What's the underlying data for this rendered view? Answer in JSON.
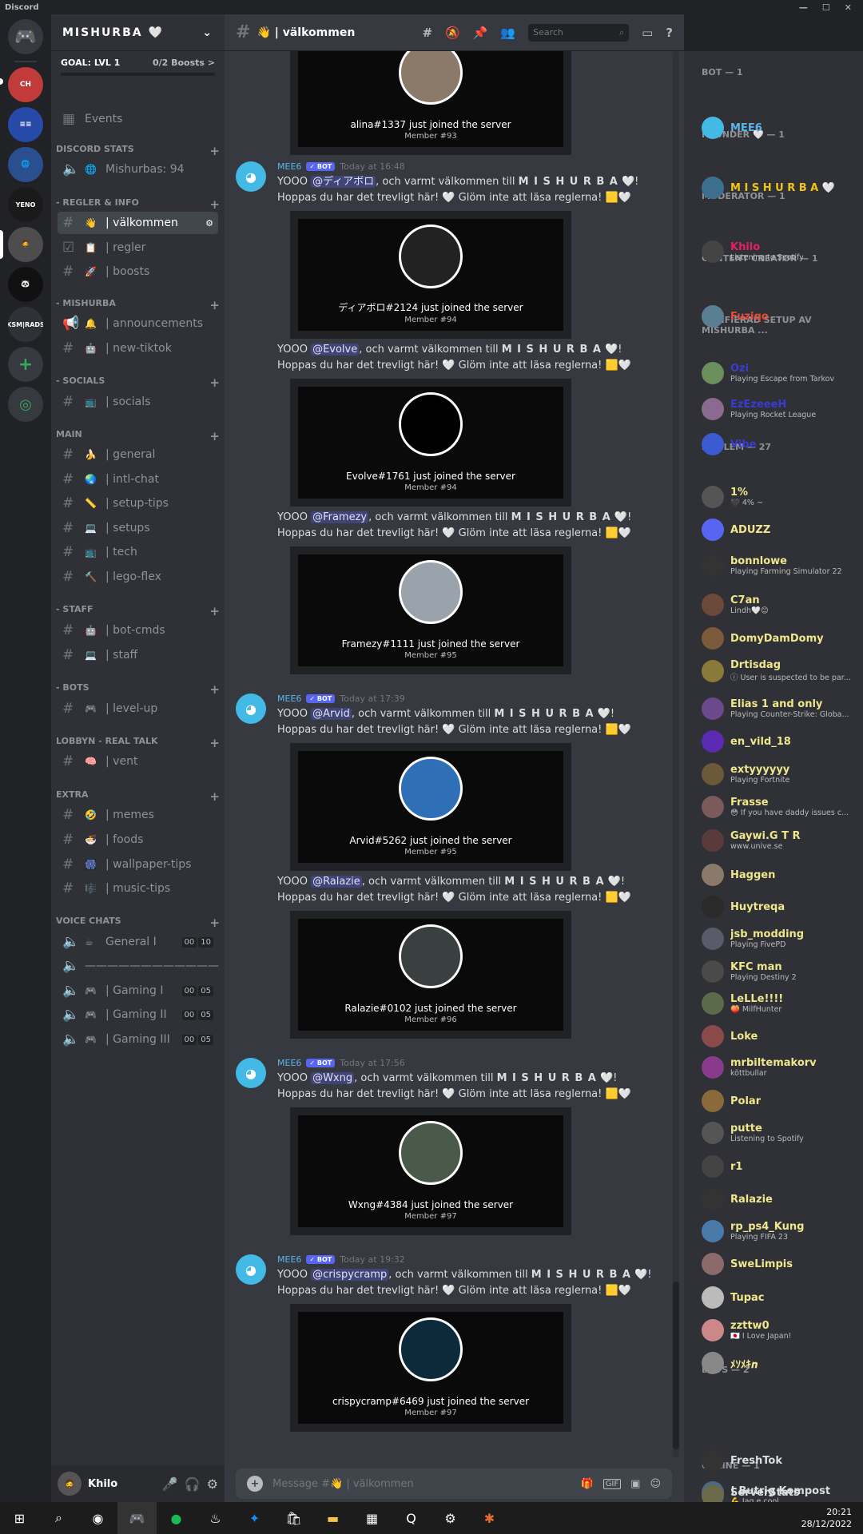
{
  "titlebar": {
    "app": "Discord"
  },
  "guild": {
    "name": "MISHURBA 🤍",
    "goal": "GOAL: LVL 1",
    "boosts": "0/2 Boosts >"
  },
  "servers": [
    {
      "label": "CH",
      "color": "#c23b3b"
    },
    {
      "label": "≡≡",
      "color": "#2749a8"
    },
    {
      "label": "🌐",
      "color": "#2a4f8f"
    },
    {
      "label": "YENO",
      "color": "#1a1a1a"
    },
    {
      "label": "🧔",
      "color": "#4d4d4d"
    },
    {
      "label": "🐼",
      "color": "#111"
    },
    {
      "label": "KSM|RADS",
      "color": "#2f3136"
    }
  ],
  "channels_list": {
    "events": "Events",
    "cat_stats": "DISCORD STATS",
    "stat_members": "Mishurbas: 94",
    "cat_rules": "- REGLER & INFO",
    "welcome": "| välkommen",
    "regler": "| regler",
    "boosts": "| boosts",
    "cat_mishurba": "- MISHURBA",
    "announcements": "| announcements",
    "newtiktok": "| new-tiktok",
    "cat_socials": "- SOCIALS",
    "socials": "| socials",
    "cat_main": "MAIN",
    "general": "| general",
    "intl": "| intl-chat",
    "setuptips": "| setup-tips",
    "setups": "| setups",
    "tech": "| tech",
    "lego": "| lego-flex",
    "cat_staff": "- STAFF",
    "botcmds": "| bot-cmds",
    "staff": "| staff",
    "cat_bots": "- BOTS",
    "levelup": "| level-up",
    "cat_lobbyn": "LOBBYN - REAL TALK",
    "vent": "| vent",
    "cat_extra": "EXTRA",
    "memes": "| memes",
    "foods": "| foods",
    "wallpaper": "| wallpaper-tips",
    "music": "| music-tips",
    "cat_voice": "VOICE CHATS",
    "general1": "General I",
    "divider": "————————————",
    "gaming1": "| Gaming I",
    "gaming2": "| Gaming II",
    "gaming3": "| Gaming III",
    "vc_g1a": "00",
    "vc_g1b": "10",
    "vc_ga": "00",
    "vc_gb": "05"
  },
  "channel_header": {
    "name": "👋 | välkommen",
    "search": "Search"
  },
  "user_panel": {
    "name": "Khilo"
  },
  "messages": {
    "bot": "MEE6",
    "badge": "✓ BOT",
    "t1": "Today at 16:48",
    "t2": "Today at 17:39",
    "t3": "Today at 17:56",
    "t4": "Today at 19:32",
    "welcome_pre": "YOOO ",
    "welcome_mid": ", och varmt välkommen till ",
    "server": "M I S H U R B A",
    "welcome_end": " 🤍! Hoppas du har det trevligt här! 🤍 Glöm inte att läsa reglerna! 🟨🤍",
    "m0": "@ディアボロ",
    "m1": "@Evolve",
    "m2": "@Framezy",
    "m3": "@Arvid",
    "m4": "@Ralazie",
    "m5": "@Wxng",
    "m6": "@crispycramp",
    "c_alina": "alina#1337 just joined the server",
    "n_alina": "Member #93",
    "c0": "ディアボロ#2124 just joined the server",
    "n0": "Member #94",
    "c1": "Evolve#1761 just joined the server",
    "n1": "Member #94",
    "c2": "Framezy#1111 just joined the server",
    "n2": "Member #95",
    "c3": "Arvid#5262 just joined the server",
    "n3": "Member #95",
    "c4": "Ralazie#0102 just joined the server",
    "n4": "Member #96",
    "c5": "Wxng#4384 just joined the server",
    "n5": "Member #97",
    "c6": "crispycramp#6469 just joined the server",
    "n6": "Member #97"
  },
  "composer": {
    "placeholder": "Message #👋 | välkommen"
  },
  "members": {
    "h_bot": "BOT — 1",
    "h_founder": "FOUNDER 🤍 — 1",
    "h_mod": "MODERATOR — 1",
    "h_cc": "CONTENT CREATOR — 1",
    "h_ver": "VERIFIERAD SETUP AV MISHURBA ...",
    "h_med": "MEDLEM — 27",
    "h_bots": "BOTS — 2",
    "h_online": "ONLINE — 1",
    "list": [
      {
        "n": "MEE6",
        "s": "",
        "c": "#5eb4e8"
      },
      {
        "n": "M I S H U R B A 🤍",
        "s": "",
        "c": "#f1c40f"
      },
      {
        "n": "Khilo",
        "s": "Listening to Spotify",
        "c": "#e91e63"
      },
      {
        "n": "Fuziqo",
        "s": "",
        "c": "#e74c3c"
      },
      {
        "n": "Ozi",
        "s": "Playing Escape from Tarkov",
        "c": "#3b3bd1"
      },
      {
        "n": "EzEzeeeH",
        "s": "Playing Rocket League",
        "c": "#3b3bd1"
      },
      {
        "n": "Vibe",
        "s": "",
        "c": "#3b3bd1"
      },
      {
        "n": "1%",
        "s": "🖤 4% ~",
        "c": "#f0e68c"
      },
      {
        "n": "ADUZZ",
        "s": "",
        "c": "#f0e68c"
      },
      {
        "n": "bonnlowe",
        "s": "Playing Farming Simulator 22",
        "c": "#f0e68c"
      },
      {
        "n": "C7an",
        "s": "Lindh🤍😊",
        "c": "#f0e68c"
      },
      {
        "n": "DomyDamDomy",
        "s": "",
        "c": "#f0e68c"
      },
      {
        "n": "Drtisdag",
        "s": "ⓘ User is suspected to be par...",
        "c": "#f0e68c"
      },
      {
        "n": "Elias 1 and only",
        "s": "Playing Counter-Strike: Globa...",
        "c": "#f0e68c"
      },
      {
        "n": "en_vild_18",
        "s": "",
        "c": "#f0e68c"
      },
      {
        "n": "extyyyyyy",
        "s": "Playing Fortnite",
        "c": "#f0e68c"
      },
      {
        "n": "Frasse",
        "s": "😳 If you have daddy issues c...",
        "c": "#f0e68c"
      },
      {
        "n": "Gaywi.G T R",
        "s": "www.unive.se",
        "c": "#f0e68c"
      },
      {
        "n": "Haggen",
        "s": "",
        "c": "#f0e68c"
      },
      {
        "n": "Huytreqa",
        "s": "",
        "c": "#f0e68c"
      },
      {
        "n": "jsb_modding",
        "s": "Playing FivePD",
        "c": "#f0e68c"
      },
      {
        "n": "KFC man",
        "s": "Playing Destiny 2",
        "c": "#f0e68c"
      },
      {
        "n": "LeLLe!!!!",
        "s": "🍑 MilfHunter",
        "c": "#f0e68c"
      },
      {
        "n": "Loke",
        "s": "",
        "c": "#f0e68c"
      },
      {
        "n": "mrbiltemakorv",
        "s": "köttbullar",
        "c": "#f0e68c"
      },
      {
        "n": "Polar",
        "s": "",
        "c": "#f0e68c"
      },
      {
        "n": "putte",
        "s": "Listening to Spotify",
        "c": "#f0e68c"
      },
      {
        "n": "r1",
        "s": "",
        "c": "#f0e68c"
      },
      {
        "n": "Ralazie",
        "s": "",
        "c": "#f0e68c"
      },
      {
        "n": "rp_ps4_Kung",
        "s": "Playing FIFA 23",
        "c": "#f0e68c"
      },
      {
        "n": "SweLimpis",
        "s": "",
        "c": "#f0e68c"
      },
      {
        "n": "Tupac",
        "s": "",
        "c": "#f0e68c"
      },
      {
        "n": "zzttw0",
        "s": "🇯🇵 I Love Japan!",
        "c": "#f0e68c"
      },
      {
        "n": "ﾒｿﾒｷ𝒏",
        "s": "",
        "c": "#f0e68c"
      },
      {
        "n": "FreshTok",
        "s": "",
        "c": "#dcddde"
      },
      {
        "n": "ServerStats",
        "s": "",
        "c": "#dcddde"
      },
      {
        "n": "! Butrig Kompost",
        "s": "💪 Jag e cool",
        "c": "#dcddde"
      }
    ]
  },
  "taskbar": {
    "time": "20:21",
    "date": "28/12/2022"
  }
}
